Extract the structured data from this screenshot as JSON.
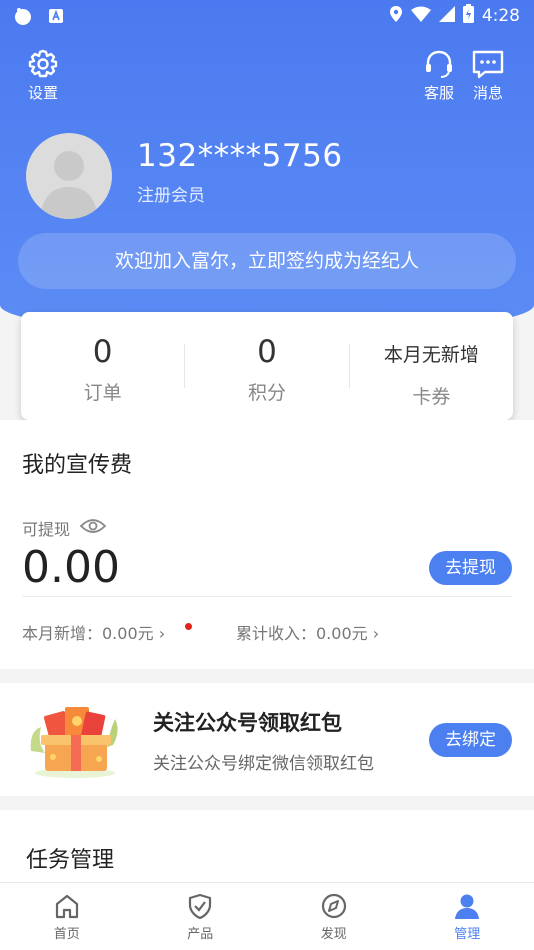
{
  "status_bar": {
    "time": "4:28"
  },
  "header": {
    "settings_label": "设置",
    "service_label": "客服",
    "message_label": "消息",
    "phone": "132****5756",
    "member_type": "注册会员",
    "welcome_banner": "欢迎加入富尔，立即签约成为经纪人"
  },
  "stats": [
    {
      "value": "0",
      "label": "订单"
    },
    {
      "value": "0",
      "label": "积分"
    },
    {
      "value": "本月无新增",
      "label": "卡券"
    }
  ],
  "promo": {
    "title": "我的宣传费",
    "withdrawable_label": "可提现",
    "amount": "0.00",
    "withdraw_button": "去提现",
    "month_new": "本月新增：0.00元",
    "total_income": "累计收入：0.00元"
  },
  "follow": {
    "title": "关注公众号领取红包",
    "subtitle": "关注公众号绑定微信领取红包",
    "bind_button": "去绑定"
  },
  "task": {
    "title": "任务管理"
  },
  "nav": [
    {
      "label": "首页",
      "icon": "home-icon"
    },
    {
      "label": "产品",
      "icon": "shield-check-icon"
    },
    {
      "label": "发现",
      "icon": "compass-icon"
    },
    {
      "label": "管理",
      "icon": "user-icon"
    }
  ],
  "colors": {
    "primary": "#4c80f1",
    "dot": "#e3231b"
  }
}
